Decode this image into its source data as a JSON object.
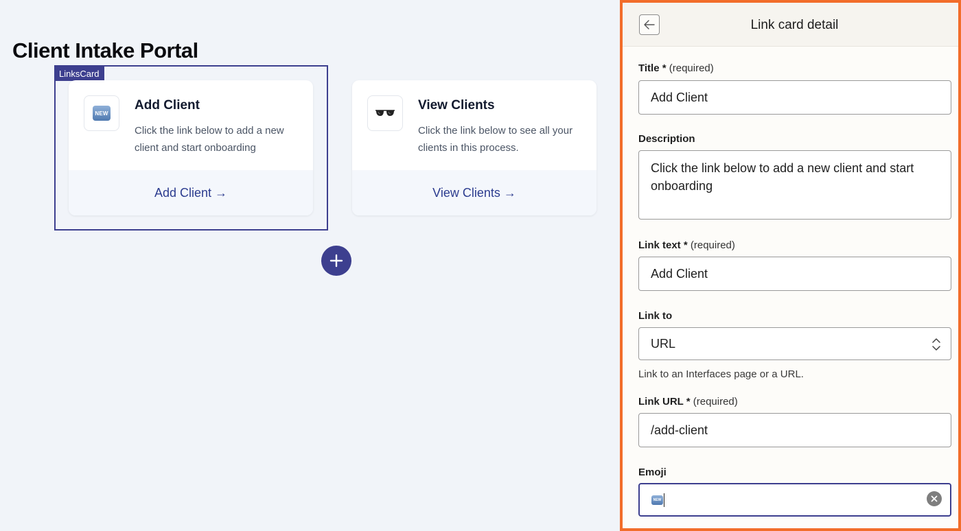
{
  "canvas": {
    "page_title": "Client Intake Portal",
    "selection_tag": "LinksCard",
    "cards": [
      {
        "emoji_icon": "new-button-emoji",
        "emoji_text": "NEW",
        "title": "Add Client",
        "description": "Click the link below to add a new client and start onboarding",
        "link_text": "Add Client →"
      },
      {
        "emoji_icon": "sunglasses-emoji",
        "title": "View Clients",
        "description": "Click the link below to see all your clients in this process.",
        "link_text": "View Clients →"
      }
    ],
    "add_block_icon": "plus-icon"
  },
  "panel": {
    "header_title": "Link card detail",
    "back_icon": "arrow-left-icon",
    "title_field": {
      "label": "Title *",
      "required": "(required)",
      "value": "Add Client"
    },
    "description_field": {
      "label": "Description",
      "value": "Click the link below to add a new client and start onboarding"
    },
    "link_text_field": {
      "label": "Link text *",
      "required": "(required)",
      "value": "Add Client"
    },
    "link_to_field": {
      "label": "Link to",
      "value": "URL",
      "hint": "Link to an Interfaces page or a URL."
    },
    "link_url_field": {
      "label": "Link URL *",
      "required": "(required)",
      "value": "/add-client"
    },
    "emoji_field": {
      "label": "Emoji",
      "value_icon": "new-button-emoji",
      "value_text": "NEW",
      "clear_icon": "clear-icon"
    }
  },
  "colors": {
    "canvas_bg": "#f1f4f9",
    "accent": "#3d3f8f",
    "panel_border": "#f26d2a",
    "link": "#2c3c8f"
  }
}
